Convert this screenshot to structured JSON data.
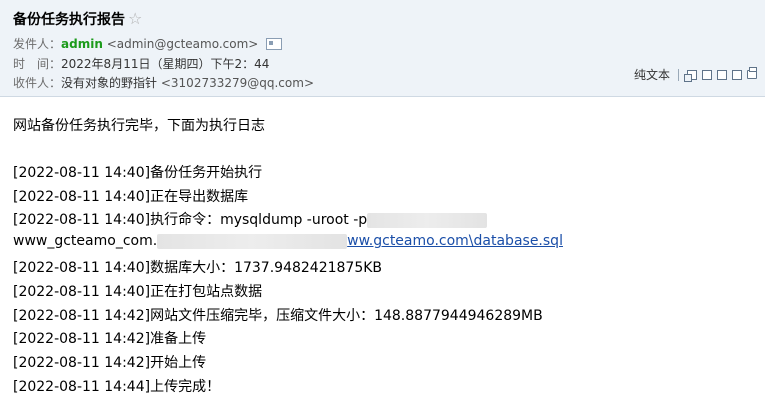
{
  "email": {
    "subject": "备份任务执行报告",
    "from_label": "发件人：",
    "from_name": "admin",
    "from_addr": "<admin@gcteamo.com>",
    "time_label": "时　间：",
    "time_value": "2022年8月11日（星期四）下午2：44",
    "to_label": "收件人：",
    "to_name": "没有对象的野指针",
    "to_addr": "<3102733279@qq.com>",
    "plain_text_label": "纯文本"
  },
  "body": {
    "intro": "网站备份任务执行完毕，下面为执行日志",
    "lines": [
      "[2022-08-11 14:40]备份任务开始执行",
      "[2022-08-11 14:40]正在导出数据库",
      "[2022-08-11 14:40]执行命令：mysqldump -uroot -p",
      "www_gcteamo_com.",
      "ww.gcteamo.com\\database.sql",
      "[2022-08-11 14:40]数据库大小：1737.9482421875KB",
      "[2022-08-11 14:40]正在打包站点数据",
      "[2022-08-11 14:42]网站文件压缩完毕，压缩文件大小：148.8877944946289MB",
      "[2022-08-11 14:42]准备上传",
      "[2022-08-11 14:42]开始上传",
      "[2022-08-11 14:44]上传完成！"
    ]
  }
}
